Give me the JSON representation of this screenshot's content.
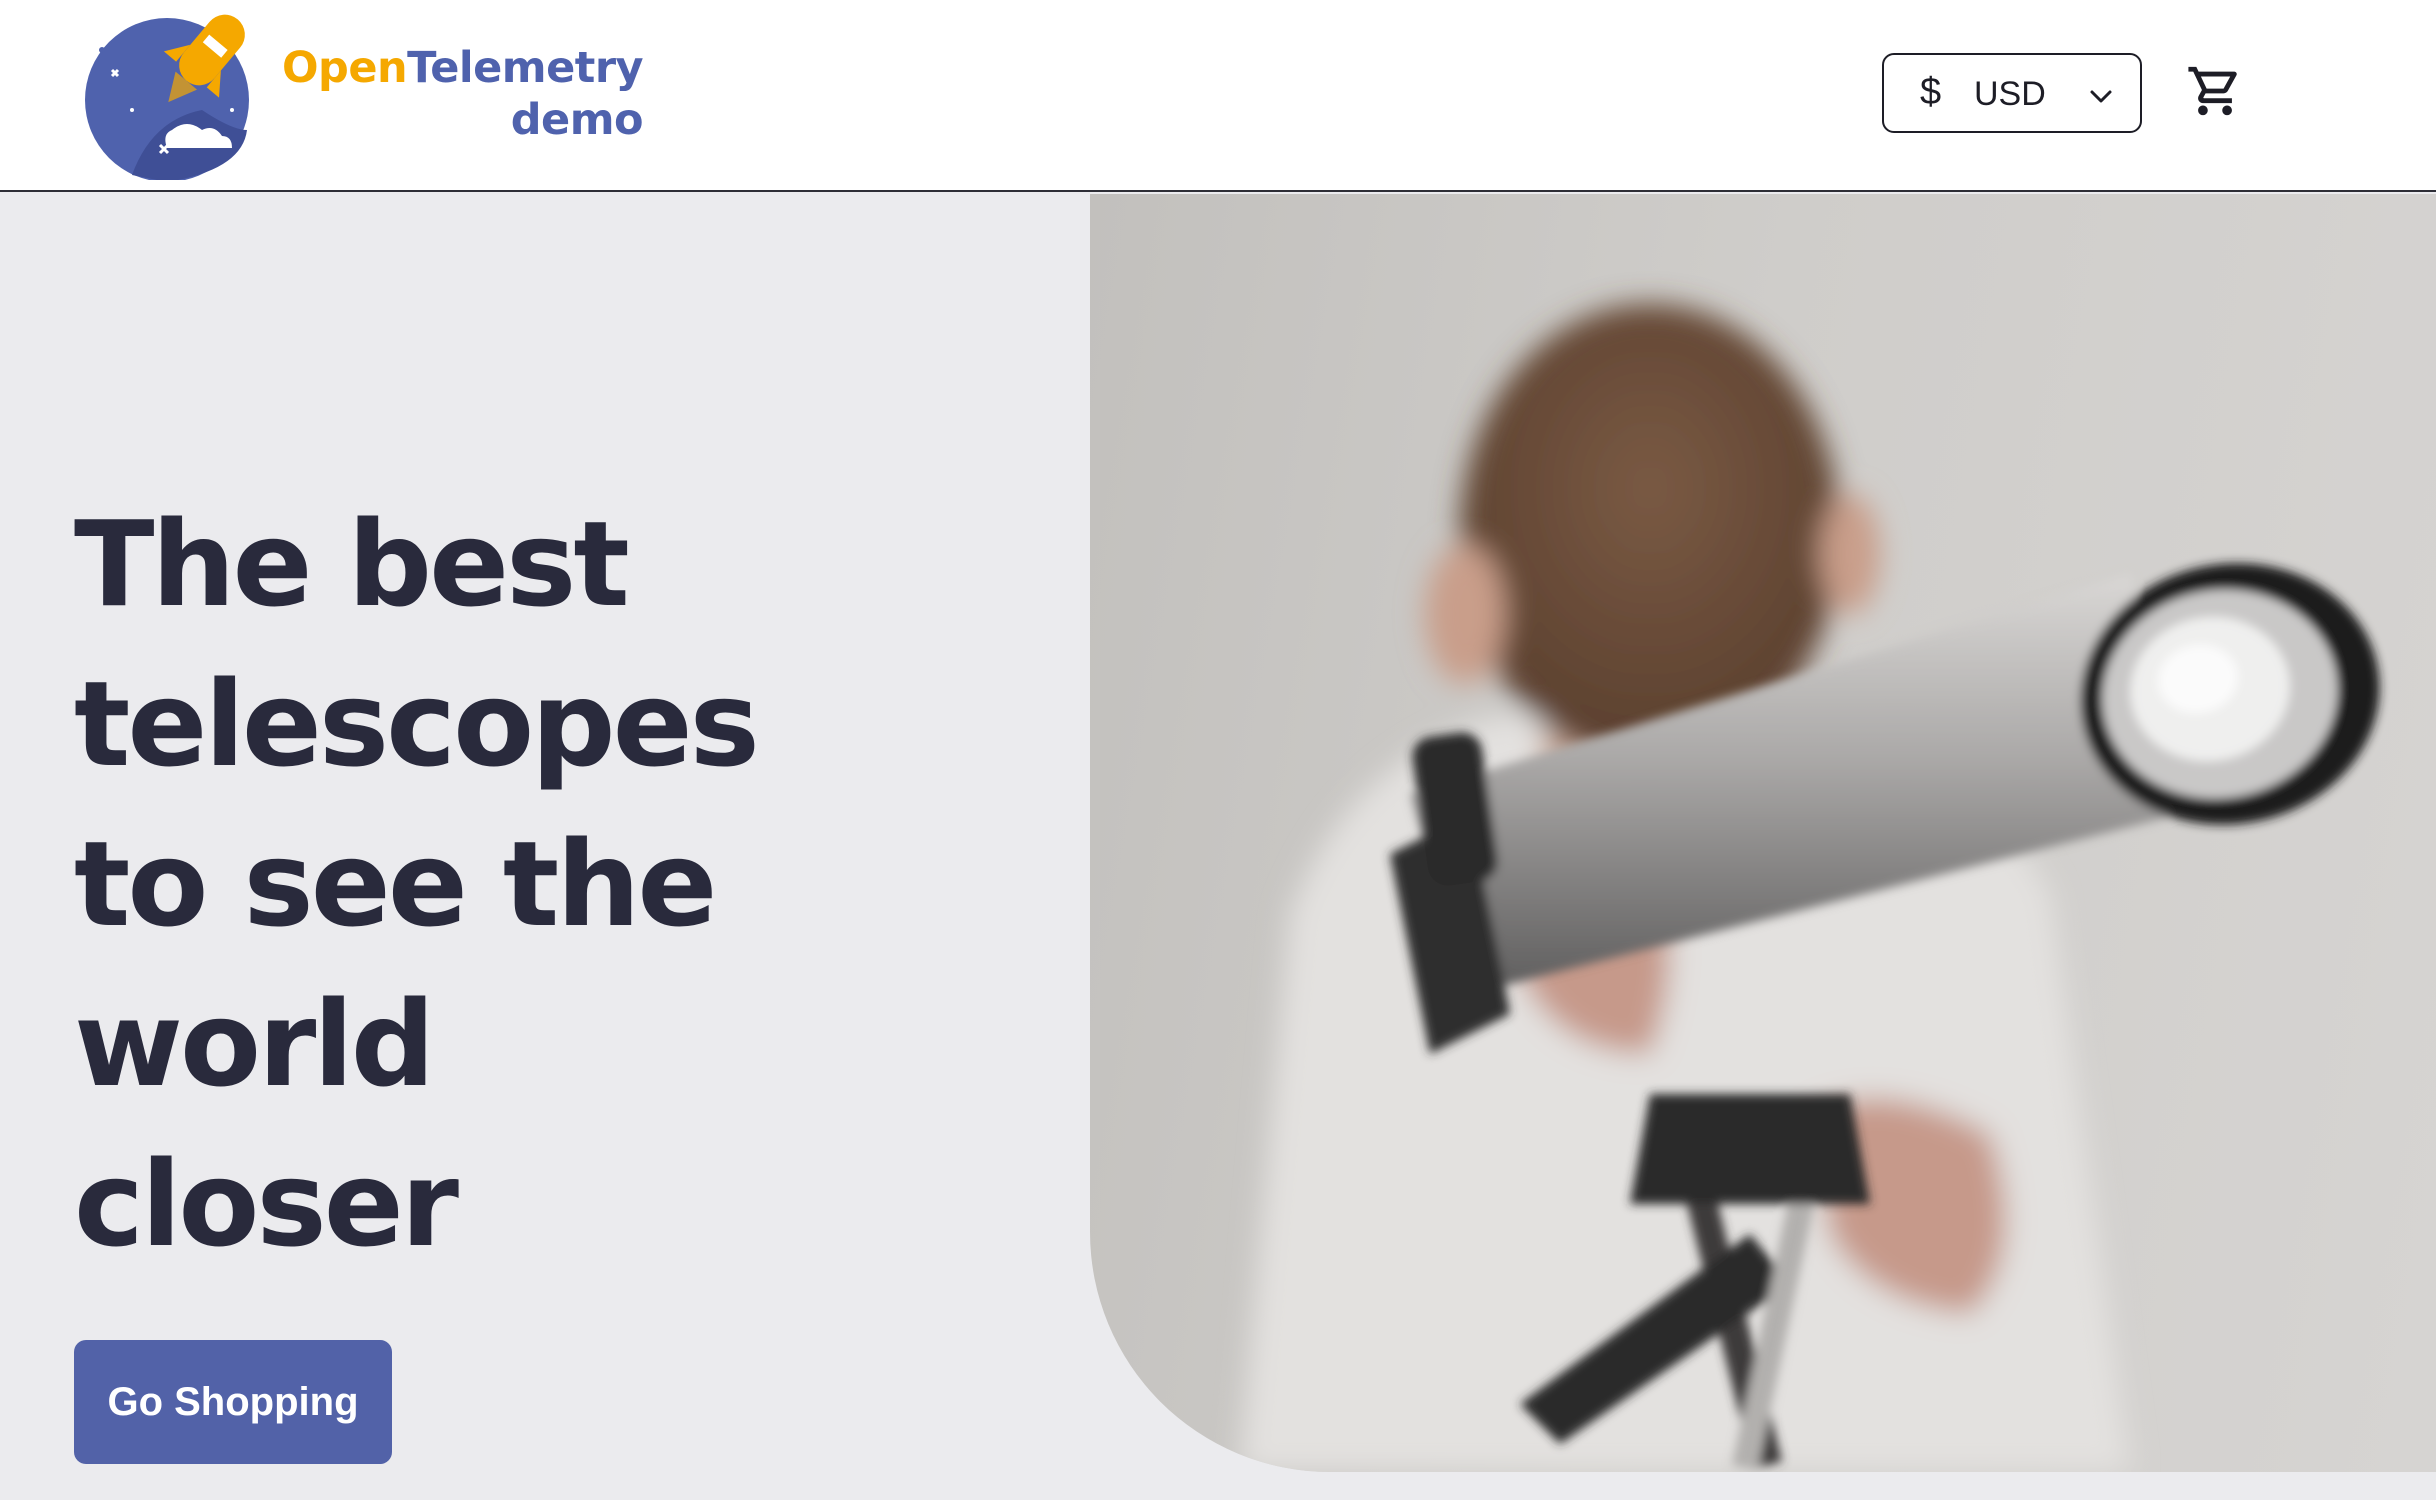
{
  "header": {
    "logo": {
      "word_open": "Open",
      "word_telemetry": "Telemetry",
      "word_demo": "demo",
      "icon": "rocket-planet-icon",
      "colors": {
        "orange": "#f5a800",
        "blue": "#4f62ad"
      }
    },
    "currency": {
      "symbol": "$",
      "selected": "USD",
      "icon": "chevron-down-icon"
    },
    "cart": {
      "icon": "shopping-cart-icon"
    }
  },
  "hero": {
    "headline_lines": [
      "The best",
      "telescopes",
      "to see the",
      "world",
      "closer"
    ],
    "cta_label": "Go Shopping",
    "image_subject": "child looking through a telescope",
    "colors": {
      "headline": "#292a3c",
      "cta_bg": "#5262a8",
      "background": "#ebebee"
    }
  }
}
